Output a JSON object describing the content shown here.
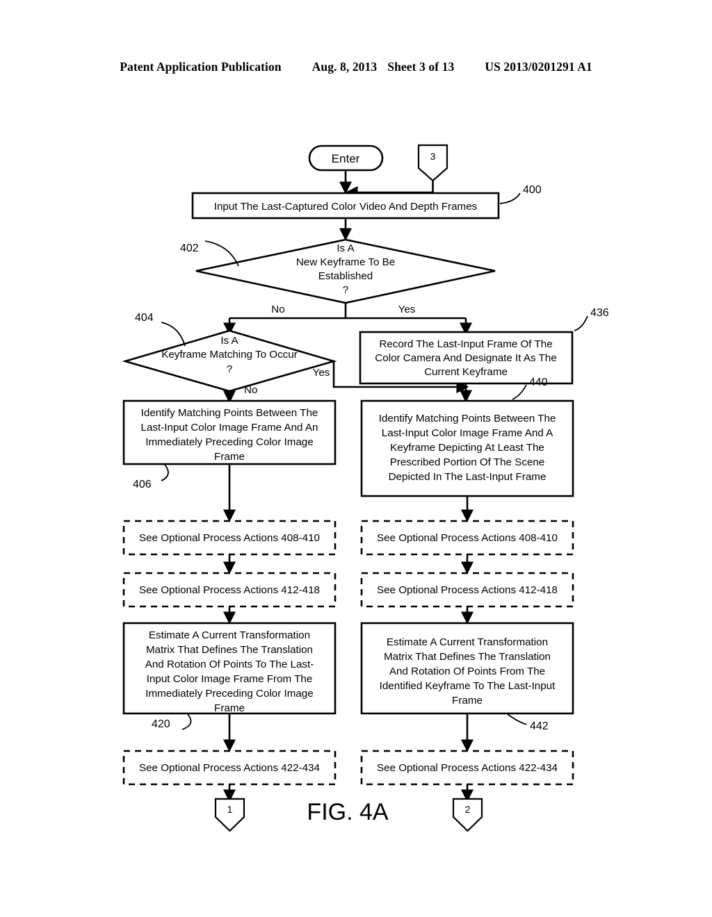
{
  "header": {
    "title": "Patent Application Publication",
    "date": "Aug. 8, 2013",
    "sheet": "Sheet 3 of 13",
    "patent_number": "US 2013/0201291 A1"
  },
  "figure": {
    "caption": "FIG. 4A",
    "entry_node": "Enter",
    "inbound_connector": "3",
    "exit_connector_left": "1",
    "exit_connector_right": "2",
    "nodes": {
      "n400": {
        "ref": "400",
        "text": "Input The Last-Captured Color Video And Depth Frames"
      },
      "n402": {
        "ref": "402",
        "line1": "Is A",
        "line2": "New Keyframe To Be",
        "line3": "Established",
        "line4": "?",
        "branch_no": "No",
        "branch_yes": "Yes"
      },
      "n404": {
        "ref": "404",
        "line1": "Is A",
        "line2": "Keyframe Matching To Occur",
        "line3": "?",
        "branch_no": "No",
        "branch_yes": "Yes"
      },
      "n436": {
        "ref": "436",
        "line1": "Record The Last-Input Frame Of The",
        "line2": "Color Camera And Designate It As The",
        "line3": "Current Keyframe"
      },
      "n406": {
        "ref": "406",
        "line1": "Identify Matching Points Between The",
        "line2": "Last-Input Color Image Frame And An",
        "line3": "Immediately Preceding Color Image",
        "line4": "Frame"
      },
      "n440": {
        "ref": "440",
        "line1": "Identify Matching Points Between The",
        "line2": "Last-Input Color Image Frame And A",
        "line3": "Keyframe Depicting At Least The",
        "line4": "Prescribed Portion Of The Scene",
        "line5": "Depicted In The Last-Input Frame"
      },
      "opt_left_408": {
        "text": "See Optional Process Actions 408-410"
      },
      "opt_right_408": {
        "text": "See Optional Process Actions 408-410"
      },
      "opt_left_412": {
        "text": "See Optional Process Actions 412-418"
      },
      "opt_right_412": {
        "text": "See Optional Process Actions 412-418"
      },
      "n420": {
        "ref": "420",
        "line1": "Estimate A Current Transformation",
        "line2": "Matrix That Defines The Translation",
        "line3": "And Rotation Of Points To The Last-",
        "line4": "Input Color Image Frame From The",
        "line5": "Immediately Preceding Color Image",
        "line6": "Frame"
      },
      "n442": {
        "ref": "442",
        "line1": "Estimate A Current Transformation",
        "line2": "Matrix That Defines The Translation",
        "line3": "And Rotation Of Points From The",
        "line4": "Identified Keyframe To The Last-Input",
        "line5": "Frame"
      },
      "opt_left_422": {
        "text": "See Optional Process Actions 422-434"
      },
      "opt_right_422": {
        "text": "See Optional Process Actions 422-434"
      }
    }
  }
}
